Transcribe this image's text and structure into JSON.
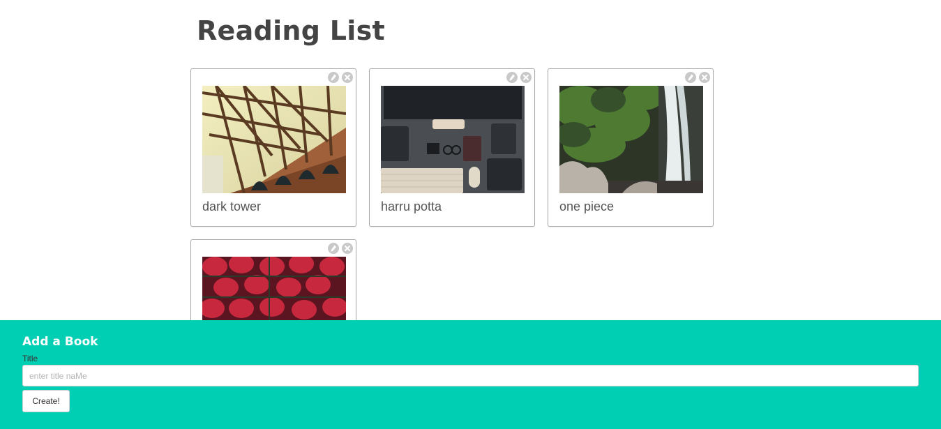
{
  "header": {
    "title": "Reading List"
  },
  "books": [
    {
      "title": "dark tower",
      "image": "bridge-photo",
      "edit_icon": "pencil-icon",
      "delete_icon": "close-icon"
    },
    {
      "title": "harru potta",
      "image": "desk-photo",
      "edit_icon": "pencil-icon",
      "delete_icon": "close-icon"
    },
    {
      "title": "one piece",
      "image": "waterfall-photo",
      "edit_icon": "pencil-icon",
      "delete_icon": "close-icon"
    },
    {
      "title": "",
      "image": "strawberries-photo",
      "edit_icon": "pencil-icon",
      "delete_icon": "close-icon"
    }
  ],
  "form": {
    "heading": "Add a Book",
    "title_label": "Title",
    "title_placeholder": "enter title naMe",
    "title_value": "",
    "submit_label": "Create!"
  },
  "colors": {
    "footer_bg": "#00cfb3",
    "icon_bg": "#c9c9c9",
    "heading_text": "#444444"
  }
}
